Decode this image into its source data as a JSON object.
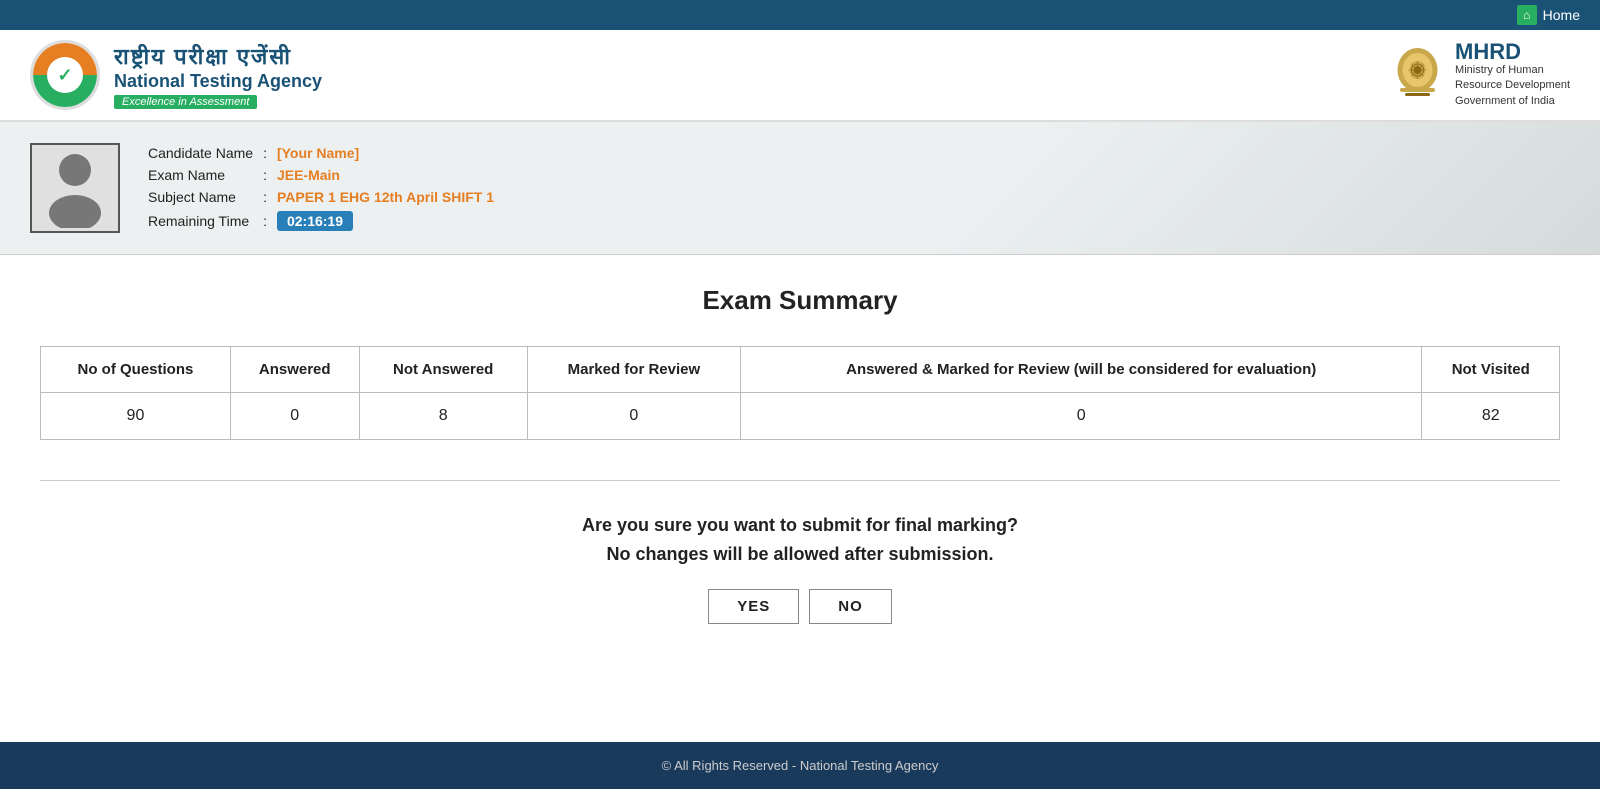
{
  "topbar": {
    "home_label": "Home"
  },
  "header": {
    "org_hindi": "राष्ट्रीय  परीक्षा  एजेंसी",
    "org_english": "National Testing Agency",
    "tagline": "Excellence in Assessment",
    "mhrd_title": "MHRD",
    "mhrd_subtitle1": "Ministry of Human",
    "mhrd_subtitle2": "Resource Development",
    "mhrd_subtitle3": "Government of India"
  },
  "candidate": {
    "name_label": "Candidate Name",
    "exam_label": "Exam Name",
    "subject_label": "Subject Name",
    "time_label": "Remaining Time",
    "name_value": "[Your Name]",
    "exam_value": "JEE-Main",
    "subject_value": "PAPER 1 EHG 12th April SHIFT 1",
    "time_value": "02:16:19"
  },
  "summary": {
    "title": "Exam Summary",
    "columns": [
      "No of Questions",
      "Answered",
      "Not Answered",
      "Marked for Review",
      "Answered & Marked for Review (will be considered for evaluation)",
      "Not Visited"
    ],
    "values": [
      90,
      0,
      8,
      0,
      0,
      82
    ]
  },
  "confirmation": {
    "line1": "Are you sure you want to submit for final marking?",
    "line2": "No changes will be allowed after submission.",
    "yes_label": "YES",
    "no_label": "NO"
  },
  "footer": {
    "text": "© All Rights Reserved - National Testing Agency"
  }
}
